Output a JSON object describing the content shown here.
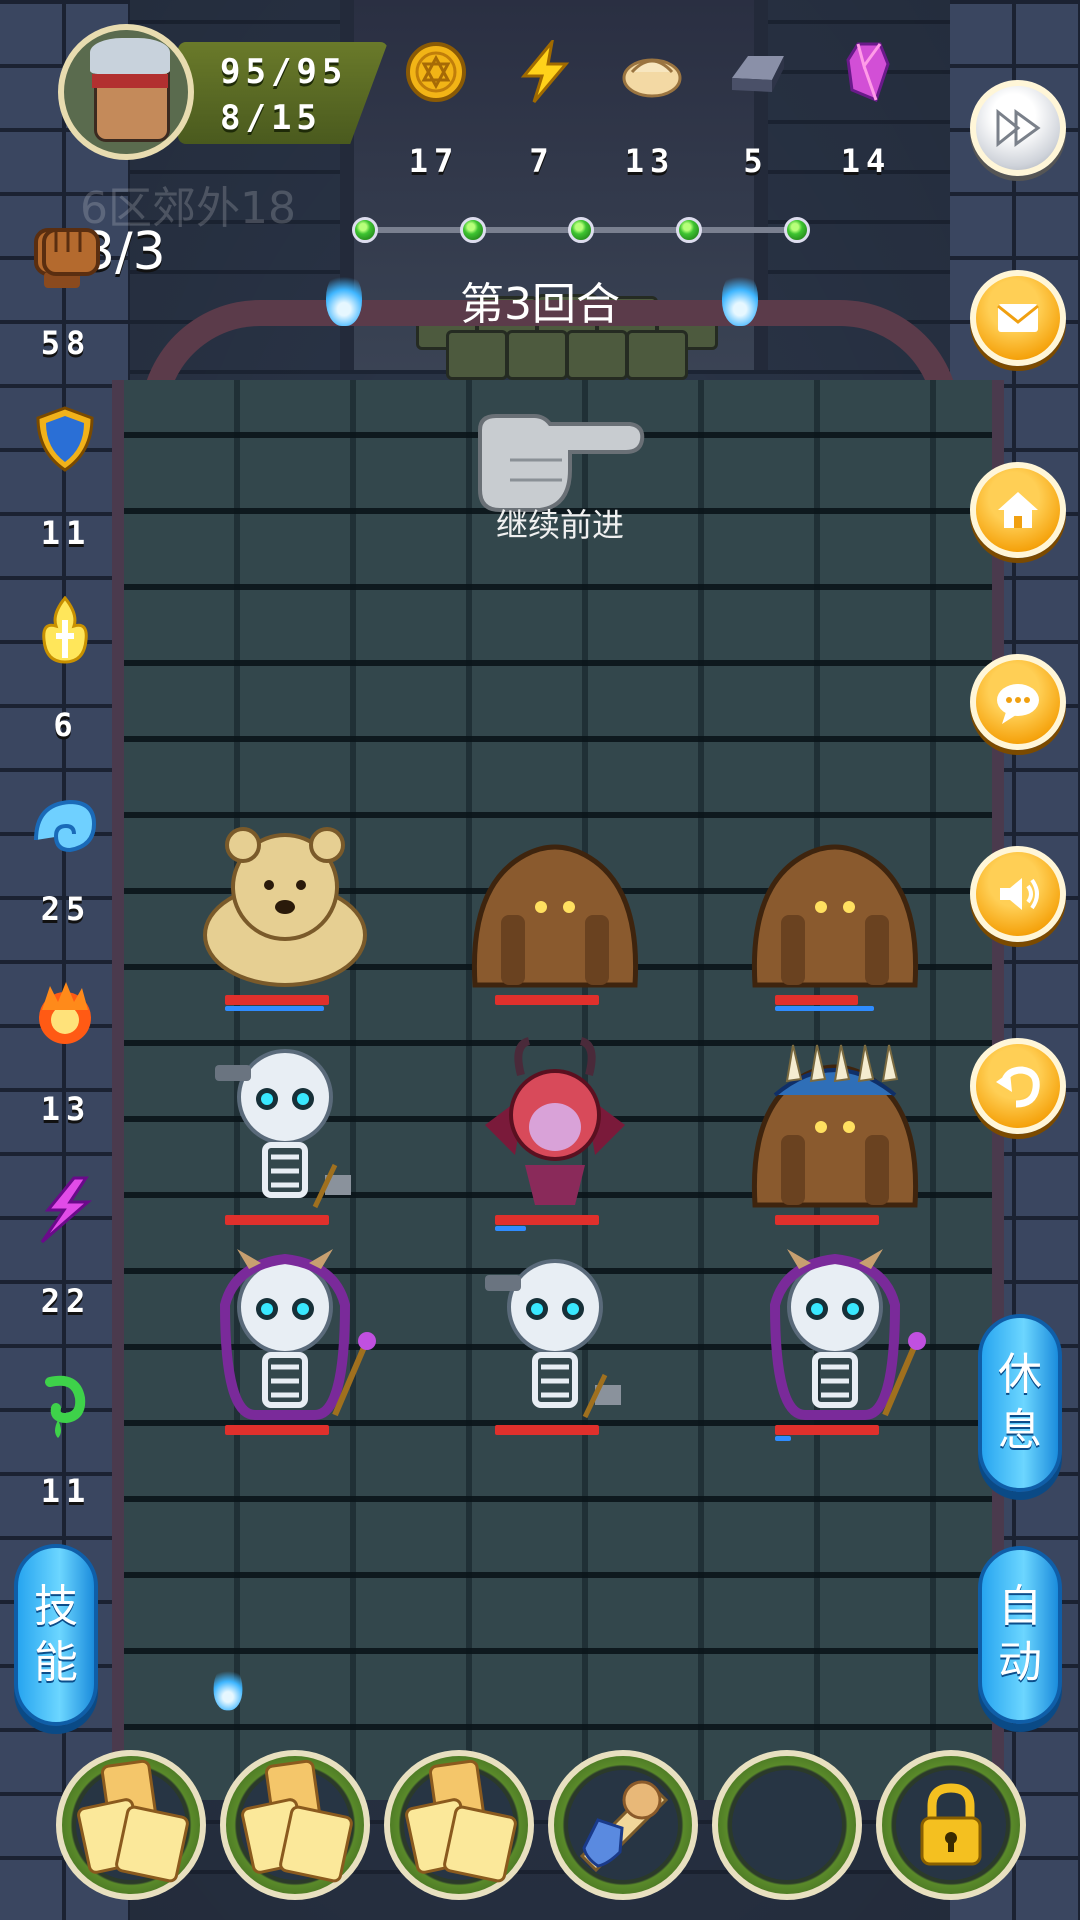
{
  "hero": {
    "hp": "95/95",
    "level_progress": "8/15"
  },
  "resources": [
    {
      "name": "gold-coin-icon",
      "value": "17"
    },
    {
      "name": "lightning-energy-icon",
      "value": "7"
    },
    {
      "name": "dumpling-icon",
      "value": "13"
    },
    {
      "name": "iron-ingot-icon",
      "value": "5"
    },
    {
      "name": "crystal-icon",
      "value": "14"
    }
  ],
  "zone_watermark": "6区郊外18",
  "round": {
    "label": "第3回合",
    "stages_total": 5
  },
  "prompt": {
    "continue_label": "继续前进"
  },
  "power": {
    "icon": "fist-icon",
    "value": "3/3"
  },
  "stats": [
    {
      "name": "attack",
      "icon": "fist-icon",
      "value": "58"
    },
    {
      "name": "defense",
      "icon": "shield-icon",
      "value": "11"
    },
    {
      "name": "holy",
      "icon": "holy-flame-icon",
      "value": "6"
    },
    {
      "name": "water",
      "icon": "wave-icon",
      "value": "25"
    },
    {
      "name": "fire",
      "icon": "fireball-icon",
      "value": "13"
    },
    {
      "name": "lightning",
      "icon": "purple-lightning-icon",
      "value": "22"
    },
    {
      "name": "poison",
      "icon": "poison-drop-icon",
      "value": "11"
    }
  ],
  "side_buttons": [
    {
      "name": "fast-forward-button",
      "icon": "fast-forward-icon"
    },
    {
      "name": "mail-button",
      "icon": "envelope-icon"
    },
    {
      "name": "home-button",
      "icon": "house-icon"
    },
    {
      "name": "chat-button",
      "icon": "speech-bubble-icon"
    },
    {
      "name": "sound-button",
      "icon": "speaker-icon"
    },
    {
      "name": "undo-button",
      "icon": "undo-arrow-icon"
    }
  ],
  "actions": {
    "rest_line1": "休",
    "rest_line2": "息",
    "auto_line1": "自",
    "auto_line2": "动",
    "skill_line1": "技",
    "skill_line2": "能"
  },
  "enemies": [
    {
      "name": "bear-monster",
      "row": 1,
      "col": 1,
      "hp": 1.0,
      "mp": 0.95
    },
    {
      "name": "mud-golem",
      "row": 1,
      "col": 2,
      "hp": 1.0,
      "mp": 0.0
    },
    {
      "name": "mud-golem",
      "row": 1,
      "col": 3,
      "hp": 0.8,
      "mp": 0.95
    },
    {
      "name": "skeleton-warrior",
      "row": 2,
      "col": 1,
      "hp": 1.0,
      "mp": 0.0
    },
    {
      "name": "demon-girl",
      "row": 2,
      "col": 2,
      "hp": 1.0,
      "mp": 0.3
    },
    {
      "name": "spiked-golem",
      "row": 2,
      "col": 3,
      "hp": 1.0,
      "mp": 0.0
    },
    {
      "name": "skeleton-mage",
      "row": 3,
      "col": 1,
      "hp": 1.0,
      "mp": 0.0
    },
    {
      "name": "skeleton-warrior",
      "row": 3,
      "col": 2,
      "hp": 1.0,
      "mp": 0.0
    },
    {
      "name": "skeleton-mage",
      "row": 3,
      "col": 3,
      "hp": 1.0,
      "mp": 0.15
    }
  ],
  "item_slots": [
    {
      "name": "item-slot-cracker",
      "icon": "cracker-icon"
    },
    {
      "name": "item-slot-cracker",
      "icon": "cracker-icon"
    },
    {
      "name": "item-slot-cracker",
      "icon": "cracker-icon"
    },
    {
      "name": "item-slot-scroll",
      "icon": "rose-shield-scroll-icon"
    },
    {
      "name": "item-slot-empty",
      "icon": ""
    },
    {
      "name": "item-slot-locked",
      "icon": "padlock-icon"
    }
  ]
}
